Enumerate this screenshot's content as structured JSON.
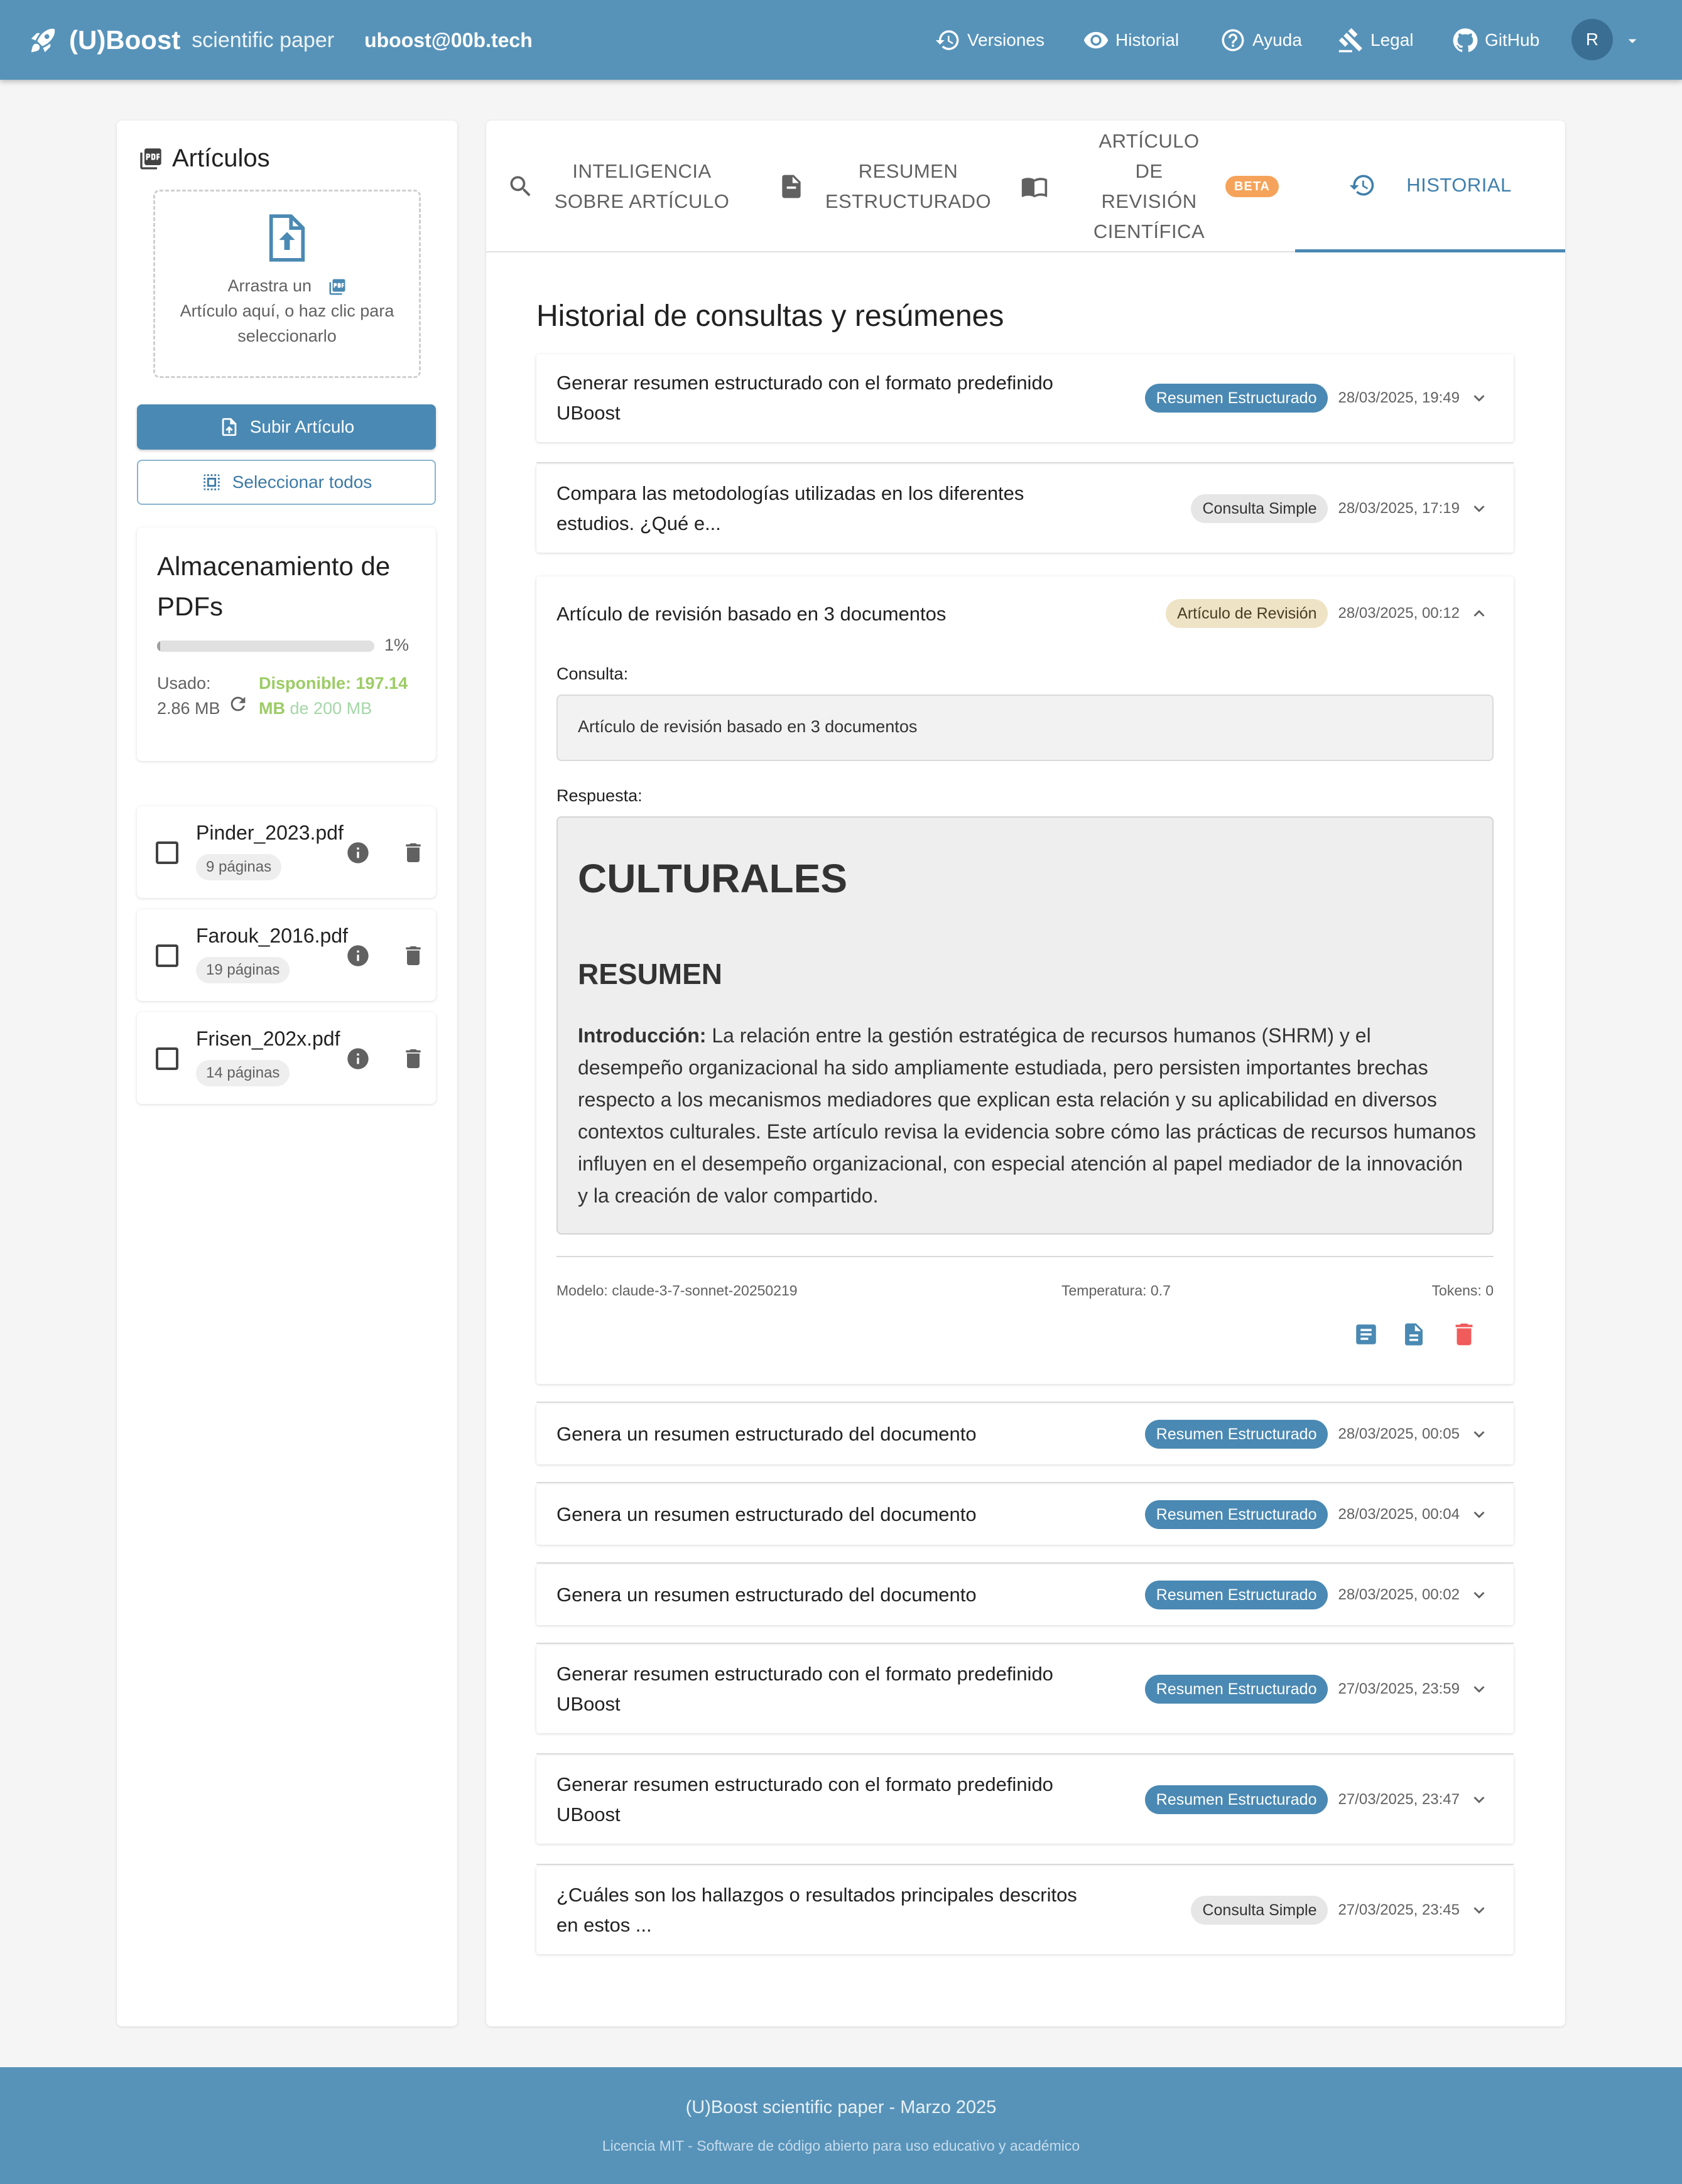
{
  "appbar": {
    "logo_text": "(U)Boost",
    "subtitle": "scientific paper",
    "email": "uboost@00b.tech",
    "nav": [
      {
        "label": "Versiones",
        "icon": "history-icon"
      },
      {
        "label": "Historial",
        "icon": "eye-icon"
      },
      {
        "label": "Ayuda",
        "icon": "help-icon"
      },
      {
        "label": "Legal",
        "icon": "gavel-icon"
      },
      {
        "label": "GitHub",
        "icon": "github-icon"
      }
    ],
    "avatar_letter": "R"
  },
  "sidebar": {
    "title": "Artículos",
    "dropzone": {
      "line1": "Arrastra un",
      "line2": "Artículo aquí, o haz clic para",
      "line3": "seleccionarlo"
    },
    "upload_label": "Subir Artículo",
    "select_all_label": "Seleccionar todos",
    "storage": {
      "title": "Almacenamiento de PDFs",
      "percent_label": "1%",
      "used_fraction": 0.014,
      "used_label": "Usado:",
      "used_value": "2.86 MB",
      "available_label": "Disponible: 197.14 MB",
      "total_label": "de 200 MB"
    },
    "files": [
      {
        "name": "Pinder_2023.pdf",
        "pages": "9 páginas"
      },
      {
        "name": "Farouk_2016.pdf",
        "pages": "19 páginas"
      },
      {
        "name": "Frisen_202x.pdf",
        "pages": "14 páginas"
      }
    ]
  },
  "tabs": [
    {
      "label_l1": "INTELIGENCIA",
      "label_l2": "SOBRE ARTÍCULO",
      "icon": "search-icon"
    },
    {
      "label_l1": "RESUMEN",
      "label_l2": "ESTRUCTURADO",
      "icon": "summary-doc-icon"
    },
    {
      "label_l1": "ARTÍCULO DE",
      "label_l2": "REVISIÓN",
      "label_l3": "CIENTÍFICA",
      "icon": "book-icon",
      "badge": "BETA"
    },
    {
      "label": "HISTORIAL",
      "icon": "history-icon",
      "active": true
    }
  ],
  "history": {
    "title": "Historial de consultas y resúmenes",
    "items": [
      {
        "text": "Generar resumen estructurado con el formato predefinido UBoost",
        "chip": "Resumen Estructurado",
        "date": "28/03/2025, 19:49"
      },
      {
        "text": "Compara las metodologías utilizadas en los diferentes estudios. ¿Qué e...",
        "chip": "Consulta Simple",
        "date": "28/03/2025, 17:19"
      },
      {
        "text": "Artículo de revisión basado en 3 documentos",
        "chip": "Artículo de Revisión",
        "date": "28/03/2025, 00:12"
      },
      {
        "text": "Genera un resumen estructurado del documento",
        "chip": "Resumen Estructurado",
        "date": "28/03/2025, 00:05"
      },
      {
        "text": "Genera un resumen estructurado del documento",
        "chip": "Resumen Estructurado",
        "date": "28/03/2025, 00:04"
      },
      {
        "text": "Genera un resumen estructurado del documento",
        "chip": "Resumen Estructurado",
        "date": "28/03/2025, 00:02"
      },
      {
        "text": "Generar resumen estructurado con el formato predefinido UBoost",
        "chip": "Resumen Estructurado",
        "date": "27/03/2025, 23:59"
      },
      {
        "text": "Generar resumen estructurado con el formato predefinido UBoost",
        "chip": "Resumen Estructurado",
        "date": "27/03/2025, 23:47"
      },
      {
        "text": "¿Cuáles son los hallazgos o resultados principales descritos en estos ...",
        "chip": "Consulta Simple",
        "date": "27/03/2025, 23:45"
      }
    ],
    "expanded": {
      "query_label": "Consulta:",
      "query": "Artículo de revisión basado en 3 documentos",
      "response_label": "Respuesta:",
      "heading1": "CULTURALES",
      "heading2": "RESUMEN",
      "intro_label": "Introducción:",
      "intro_text": " La relación entre la gestión estratégica de recursos humanos (SHRM) y el desempeño organizacional ha sido ampliamente estudiada, pero persisten importantes brechas respecto a los mecanismos mediadores que explican esta relación y su aplicabilidad en diversos contextos culturales. Este artículo revisa la evidencia sobre cómo las prácticas de recursos humanos influyen en el desempeño organizacional, con especial atención al papel mediador de la innovación y la creación de valor compartido.",
      "model": "Modelo: claude-3-7-sonnet-20250219",
      "temperature": "Temperatura: 0.7",
      "tokens": "Tokens: 0"
    }
  },
  "colors": {
    "primary": "#5793b9",
    "chip_blue": "#4a89b3",
    "beta": "#f5a35a",
    "delete": "#f05b5b",
    "available": "#8bc34a"
  },
  "footer": {
    "line1": "(U)Boost scientific paper - Marzo 2025",
    "line2": "Licencia MIT - Software de código abierto para uso educativo y académico"
  }
}
